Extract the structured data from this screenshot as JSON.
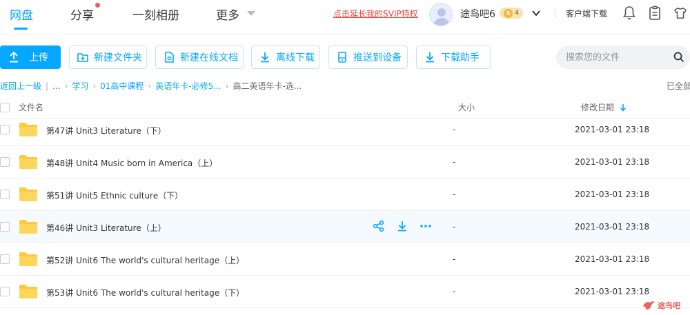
{
  "topnav": {
    "tabs": [
      {
        "label": "网盘",
        "active": true
      },
      {
        "label": "分享",
        "active": false
      },
      {
        "label": "一刻相册",
        "active": false
      },
      {
        "label": "更多",
        "active": false
      }
    ],
    "svip_promo": "点击延长我的SVIP特权",
    "username": "途鸟吧6",
    "vip_level": "4",
    "vip_symbol": "S",
    "client_download": "客户端下载",
    "icons": [
      "bell-icon",
      "clipboard-icon",
      "shirt-icon"
    ],
    "accent_color": "#06a7ff",
    "promo_color": "#f3413e"
  },
  "toolbar": {
    "upload": "上传",
    "new_folder": "新建文件夹",
    "new_online_doc": "新建在线文档",
    "offline_download": "离线下载",
    "push_to_device": "推送到设备",
    "download_helper": "下载助手",
    "search_placeholder": "搜索您的文件"
  },
  "breadcrumb": {
    "back": "返回上一级",
    "ellipsis": "...",
    "items": [
      "学习",
      "01高中课程",
      "英语年卡-必修5...",
      "高二英语年卡-选..."
    ],
    "loaded_all": "已全部"
  },
  "table": {
    "columns": {
      "name": "文件名",
      "size": "大小",
      "modified": "修改日期"
    },
    "sort": "modified-desc",
    "rows": [
      {
        "name": "第47讲 Unit3 Literature（下）",
        "size": "-",
        "modified": "2021-03-01 23:18"
      },
      {
        "name": "第48讲 Unit4 Music born in America（上）",
        "size": "-",
        "modified": "2021-03-01 23:18"
      },
      {
        "name": "第51讲 Unit5 Ethnic culture（下）",
        "size": "-",
        "modified": "2021-03-01 23:18"
      },
      {
        "name": "第46讲 Unit3 Literature（上）",
        "size": "-",
        "modified": "2021-03-01 23:18",
        "hovered": true
      },
      {
        "name": "第52讲 Unit6 The world's cultural heritage（上）",
        "size": "-",
        "modified": "2021-03-01 23:18"
      },
      {
        "name": "第53讲 Unit6 The world's cultural heritage（下）",
        "size": "-",
        "modified": "2021-03-01 23:18"
      }
    ]
  },
  "watermark": {
    "text": "途鸟吧"
  }
}
